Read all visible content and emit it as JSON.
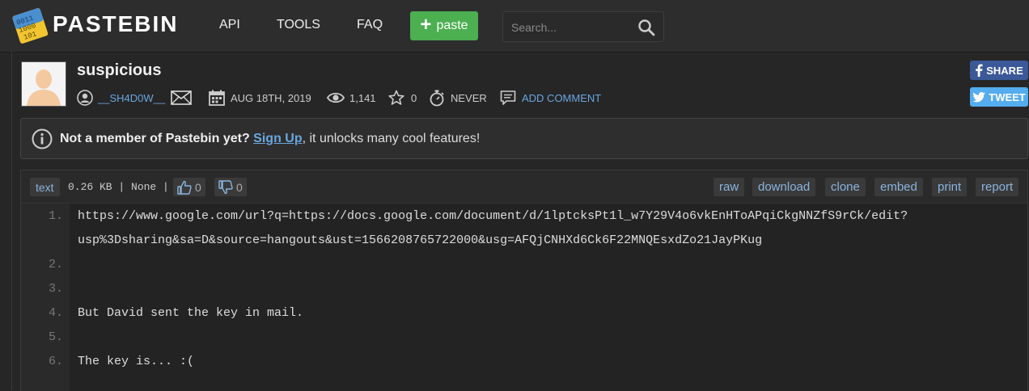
{
  "header": {
    "logo_text": "PASTEBIN",
    "nav": [
      "API",
      "TOOLS",
      "FAQ"
    ],
    "paste_button": "paste",
    "search_placeholder": "Search..."
  },
  "paste": {
    "title": "suspicious",
    "author": "__SH4D0W__",
    "date": "AUG 18TH, 2019",
    "views": "1,141",
    "stars": "0",
    "expires": "NEVER",
    "add_comment": "ADD COMMENT"
  },
  "social": {
    "share": "SHARE",
    "tweet": "TWEET",
    "facebook_color": "#3b5998",
    "twitter_color": "#55acee"
  },
  "notice": {
    "lead": "Not a member of Pastebin yet?",
    "link": "Sign Up",
    "tail": ", it unlocks many cool features!"
  },
  "code_toolbar": {
    "syntax": "text",
    "info": "0.26 KB | None |",
    "likes": "0",
    "dislikes": "0",
    "actions": [
      "raw",
      "download",
      "clone",
      "embed",
      "print",
      "report"
    ]
  },
  "code": [
    {
      "num": "1.",
      "text": "https://www.google.com/url?q=https://docs.google.com/document/d/1lptcksPt1l_w7Y29V4o6vkEnHToAPqiCkgNNZfS9rCk/edit?"
    },
    {
      "num": "",
      "text": "usp%3Dsharing&sa=D&source=hangouts&ust=1566208765722000&usg=AFQjCNHXd6Ck6F22MNQEsxdZo21JayPKug"
    },
    {
      "num": "2.",
      "text": ""
    },
    {
      "num": "3.",
      "text": ""
    },
    {
      "num": "4.",
      "text": "But David sent the key in mail."
    },
    {
      "num": "5.",
      "text": ""
    },
    {
      "num": "6.",
      "text": "The key is... :("
    }
  ]
}
